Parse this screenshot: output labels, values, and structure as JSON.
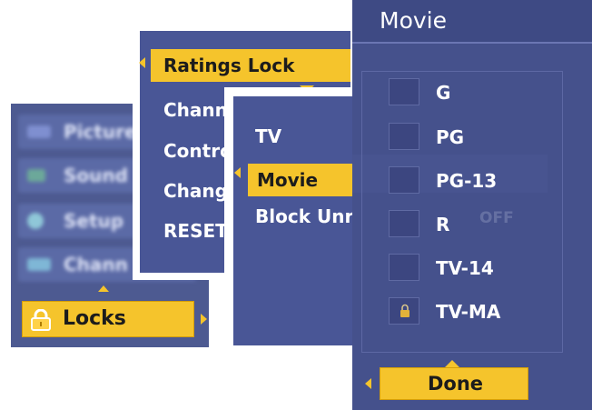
{
  "main_menu": {
    "items": [
      {
        "label": "Picture",
        "icon": "picture-icon"
      },
      {
        "label": "Sound",
        "icon": "speaker-icon"
      },
      {
        "label": "Setup",
        "icon": "gear-icon"
      },
      {
        "label": "Chann",
        "icon": "channel-icon"
      }
    ],
    "selected": {
      "label": "Locks",
      "icon": "lock-icon"
    }
  },
  "locks_menu": {
    "selected": "Ratings Lock",
    "items": [
      "Chann",
      "Contro",
      "Chang",
      "RESET"
    ]
  },
  "type_menu": {
    "items": [
      "TV"
    ],
    "selected": "Movie",
    "block_label": "Block Unr",
    "block_value": "OFF"
  },
  "movie_panel": {
    "title": "Movie",
    "ratings": [
      {
        "label": "G",
        "locked": false
      },
      {
        "label": "PG",
        "locked": false
      },
      {
        "label": "PG-13",
        "locked": false
      },
      {
        "label": "R",
        "locked": false
      },
      {
        "label": "TV-14",
        "locked": false
      },
      {
        "label": "TV-MA",
        "locked": true
      }
    ],
    "done_label": "Done"
  },
  "colors": {
    "accent": "#f5c42c",
    "panel": "#495696",
    "panel_dark": "#45518c"
  }
}
